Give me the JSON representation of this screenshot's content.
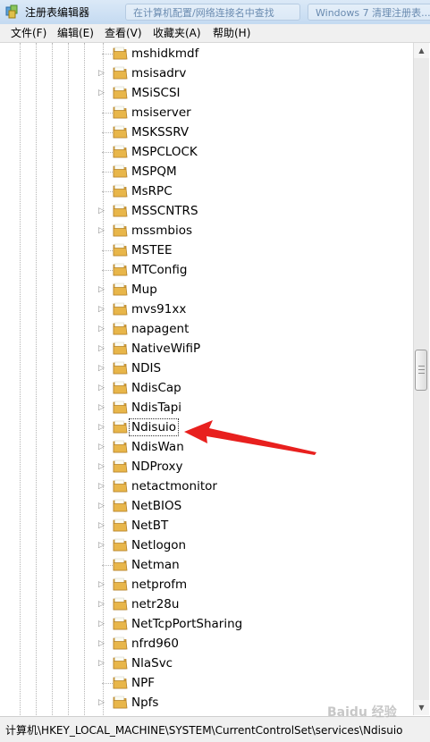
{
  "window": {
    "title": "注册表编辑器",
    "ghost_tabs": [
      "在计算机配置/网络连接名中查找",
      "Windows 7 清理注册表..."
    ]
  },
  "menu": [
    "文件(F)",
    "编辑(E)",
    "查看(V)",
    "收藏夹(A)",
    "帮助(H)"
  ],
  "tree": {
    "items": [
      {
        "label": "mshidkmdf",
        "expandable": false
      },
      {
        "label": "msisadrv",
        "expandable": true
      },
      {
        "label": "MSiSCSI",
        "expandable": true
      },
      {
        "label": "msiserver",
        "expandable": false
      },
      {
        "label": "MSKSSRV",
        "expandable": false
      },
      {
        "label": "MSPCLOCK",
        "expandable": false
      },
      {
        "label": "MSPQM",
        "expandable": false
      },
      {
        "label": "MsRPC",
        "expandable": false
      },
      {
        "label": "MSSCNTRS",
        "expandable": true
      },
      {
        "label": "mssmbios",
        "expandable": true
      },
      {
        "label": "MSTEE",
        "expandable": false
      },
      {
        "label": "MTConfig",
        "expandable": false
      },
      {
        "label": "Mup",
        "expandable": true
      },
      {
        "label": "mvs91xx",
        "expandable": true
      },
      {
        "label": "napagent",
        "expandable": true
      },
      {
        "label": "NativeWifiP",
        "expandable": true
      },
      {
        "label": "NDIS",
        "expandable": true
      },
      {
        "label": "NdisCap",
        "expandable": true
      },
      {
        "label": "NdisTapi",
        "expandable": true
      },
      {
        "label": "Ndisuio",
        "expandable": true,
        "selected": true
      },
      {
        "label": "NdisWan",
        "expandable": true
      },
      {
        "label": "NDProxy",
        "expandable": true
      },
      {
        "label": "netactmonitor",
        "expandable": true
      },
      {
        "label": "NetBIOS",
        "expandable": true
      },
      {
        "label": "NetBT",
        "expandable": true
      },
      {
        "label": "Netlogon",
        "expandable": true
      },
      {
        "label": "Netman",
        "expandable": false
      },
      {
        "label": "netprofm",
        "expandable": true
      },
      {
        "label": "netr28u",
        "expandable": true
      },
      {
        "label": "NetTcpPortSharing",
        "expandable": true
      },
      {
        "label": "nfrd960",
        "expandable": true
      },
      {
        "label": "NlaSvc",
        "expandable": true
      },
      {
        "label": "NPF",
        "expandable": false
      },
      {
        "label": "Npfs",
        "expandable": true
      }
    ]
  },
  "status": {
    "path": "计算机\\HKEY_LOCAL_MACHINE\\SYSTEM\\CurrentControlSet\\services\\Ndisuio"
  },
  "watermark": "Baidu 经验",
  "colors": {
    "folder": "#e8b64a",
    "annotation_arrow": "#e8201e"
  }
}
